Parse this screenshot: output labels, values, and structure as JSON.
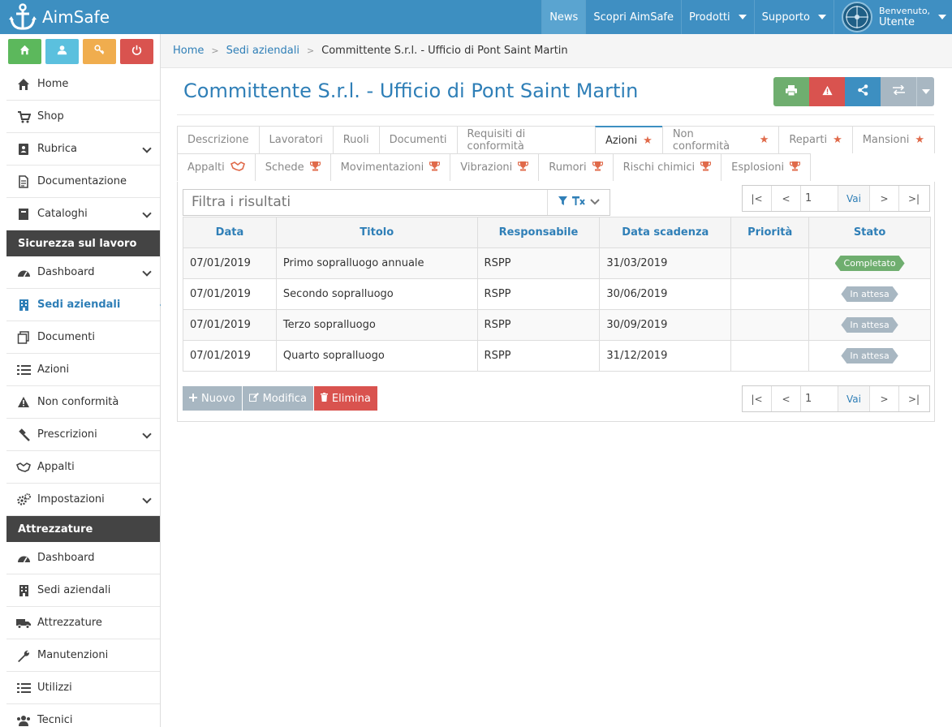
{
  "app": {
    "title": "AimSafe"
  },
  "topnav": {
    "news": "News",
    "discover": "Scopri AimSafe",
    "products": "Prodotti",
    "support": "Supporto",
    "welcome": "Benvenuto,",
    "user": "Utente"
  },
  "quick_buttons": [
    {
      "icon": "home-icon",
      "color": "#5cb85c"
    },
    {
      "icon": "user-icon",
      "color": "#5bc0de"
    },
    {
      "icon": "key-icon",
      "color": "#f0ad4e"
    },
    {
      "icon": "power-icon",
      "color": "#d9534f"
    }
  ],
  "sidebar": {
    "items_top": [
      {
        "label": "Home",
        "icon": "home-icon"
      },
      {
        "label": "Shop",
        "icon": "cart-icon"
      },
      {
        "label": "Rubrica",
        "icon": "address-book-icon",
        "expandable": true
      },
      {
        "label": "Documentazione",
        "icon": "document-icon"
      },
      {
        "label": "Cataloghi",
        "icon": "catalog-icon",
        "expandable": true
      }
    ],
    "section1": "Sicurezza sul lavoro",
    "items_safety": [
      {
        "label": "Dashboard",
        "icon": "dashboard-icon",
        "expandable": true
      },
      {
        "label": "Sedi aziendali",
        "icon": "building-icon",
        "active": true
      },
      {
        "label": "Documenti",
        "icon": "documents-icon"
      },
      {
        "label": "Azioni",
        "icon": "list-icon"
      },
      {
        "label": "Non conformità",
        "icon": "warning-icon"
      },
      {
        "label": "Prescrizioni",
        "icon": "gavel-icon",
        "expandable": true
      },
      {
        "label": "Appalti",
        "icon": "handshake-icon"
      },
      {
        "label": "Impostazioni",
        "icon": "gears-icon",
        "expandable": true
      }
    ],
    "section2": "Attrezzature",
    "items_equipment": [
      {
        "label": "Dashboard",
        "icon": "dashboard-icon"
      },
      {
        "label": "Sedi aziendali",
        "icon": "building-icon"
      },
      {
        "label": "Attrezzature",
        "icon": "truck-icon"
      },
      {
        "label": "Manutenzioni",
        "icon": "wrench-icon"
      },
      {
        "label": "Utilizzi",
        "icon": "list-icon"
      },
      {
        "label": "Tecnici",
        "icon": "users-icon"
      }
    ]
  },
  "breadcrumb": {
    "home": "Home",
    "sites": "Sedi aziendali",
    "current": "Committente S.r.l. - Ufficio di Pont Saint Martin"
  },
  "page": {
    "title": "Committente S.r.l. - Ufficio di Pont Saint Martin"
  },
  "action_buttons": [
    {
      "icon": "print-icon",
      "color": "#6fae6f"
    },
    {
      "icon": "warning-icon",
      "color": "#d9534f"
    },
    {
      "icon": "share-icon",
      "color": "#3d8fc1"
    },
    {
      "icon": "transfer-icon",
      "color": "#a8b7c2"
    }
  ],
  "tabs_row1": [
    {
      "label": "Descrizione"
    },
    {
      "label": "Lavoratori"
    },
    {
      "label": "Ruoli"
    },
    {
      "label": "Documenti"
    },
    {
      "label": "Requisiti di conformità"
    },
    {
      "label": "Azioni",
      "active": true,
      "marker": "star"
    },
    {
      "label": "Non conformità",
      "marker": "star"
    },
    {
      "label": "Reparti",
      "marker": "star"
    },
    {
      "label": "Mansioni",
      "marker": "star"
    }
  ],
  "tabs_row2": [
    {
      "label": "Appalti",
      "marker": "handshake"
    },
    {
      "label": "Schede",
      "marker": "trophy"
    },
    {
      "label": "Movimentazioni",
      "marker": "trophy"
    },
    {
      "label": "Vibrazioni",
      "marker": "trophy"
    },
    {
      "label": "Rumori",
      "marker": "trophy"
    },
    {
      "label": "Rischi chimici",
      "marker": "trophy"
    },
    {
      "label": "Esplosioni",
      "marker": "trophy"
    }
  ],
  "filter": {
    "placeholder": "Filtra i risultati"
  },
  "pager": {
    "first": "|<",
    "prev": "<",
    "page": "1",
    "go": "Vai",
    "next": ">",
    "last": ">|"
  },
  "table": {
    "columns": [
      "Data",
      "Titolo",
      "Responsabile",
      "Data scadenza",
      "Priorità",
      "Stato"
    ],
    "rows": [
      {
        "data": "07/01/2019",
        "titolo": "Primo sopralluogo annuale",
        "responsabile": "RSPP",
        "scadenza": "31/03/2019",
        "priorita": "",
        "stato": "Completato",
        "stato_color": "#6fae6f"
      },
      {
        "data": "07/01/2019",
        "titolo": "Secondo sopralluogo",
        "responsabile": "RSPP",
        "scadenza": "30/06/2019",
        "priorita": "",
        "stato": "In attesa",
        "stato_color": "#a8b7c2"
      },
      {
        "data": "07/01/2019",
        "titolo": "Terzo sopralluogo",
        "responsabile": "RSPP",
        "scadenza": "30/09/2019",
        "priorita": "",
        "stato": "In attesa",
        "stato_color": "#a8b7c2"
      },
      {
        "data": "07/01/2019",
        "titolo": "Quarto sopralluogo",
        "responsabile": "RSPP",
        "scadenza": "31/12/2019",
        "priorita": "",
        "stato": "In attesa",
        "stato_color": "#a8b7c2"
      }
    ]
  },
  "footer_buttons": {
    "new": "Nuovo",
    "edit": "Modifica",
    "delete": "Elimina"
  }
}
